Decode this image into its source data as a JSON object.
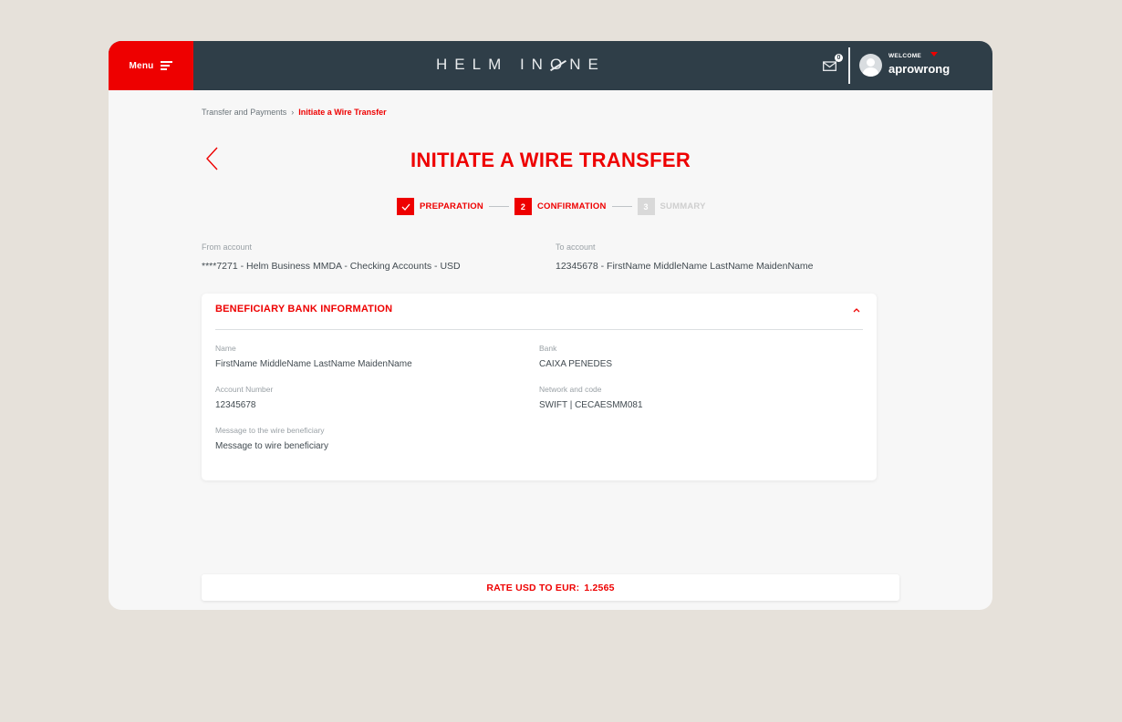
{
  "header": {
    "menu_label": "Menu",
    "logo_text_left": "HELM IN",
    "logo_text_o": "O",
    "logo_text_right": "NE",
    "inbox_count": "0",
    "welcome_label": "WELCOME",
    "username": "aprowrong"
  },
  "breadcrumb": {
    "parent": "Transfer and Payments",
    "separator": "›",
    "current": "Initiate a Wire Transfer"
  },
  "page": {
    "title": "INITIATE A WIRE TRANSFER"
  },
  "stepper": {
    "steps": [
      {
        "number": "",
        "label": "PREPARATION",
        "state": "done"
      },
      {
        "number": "2",
        "label": "CONFIRMATION",
        "state": "active"
      },
      {
        "number": "3",
        "label": "SUMMARY",
        "state": "pending"
      }
    ]
  },
  "accounts": {
    "from_label": "From account",
    "from_value": "****7271 - Helm Business MMDA - Checking Accounts - USD",
    "to_label": "To account",
    "to_value": "12345678 - FirstName MiddleName LastName MaidenName"
  },
  "beneficiary": {
    "header": "BENEFICIARY BANK INFORMATION",
    "fields": {
      "name_label": "Name",
      "name_value": "FirstName MiddleName LastName MaidenName",
      "bank_label": "Bank",
      "bank_value": "CAIXA PENEDES",
      "account_label": "Account Number",
      "account_value": "12345678",
      "network_label": "Network and code",
      "network_value": "SWIFT | CECAESMM081",
      "message_label": "Message to the wire beneficiary",
      "message_value": "Message to wire beneficiary"
    }
  },
  "rate": {
    "label": "RATE USD TO EUR:",
    "value": "1.2565"
  },
  "colors": {
    "brand_red": "#ee0000",
    "topbar": "#2f3e48",
    "page_bg": "#e6e1da"
  }
}
